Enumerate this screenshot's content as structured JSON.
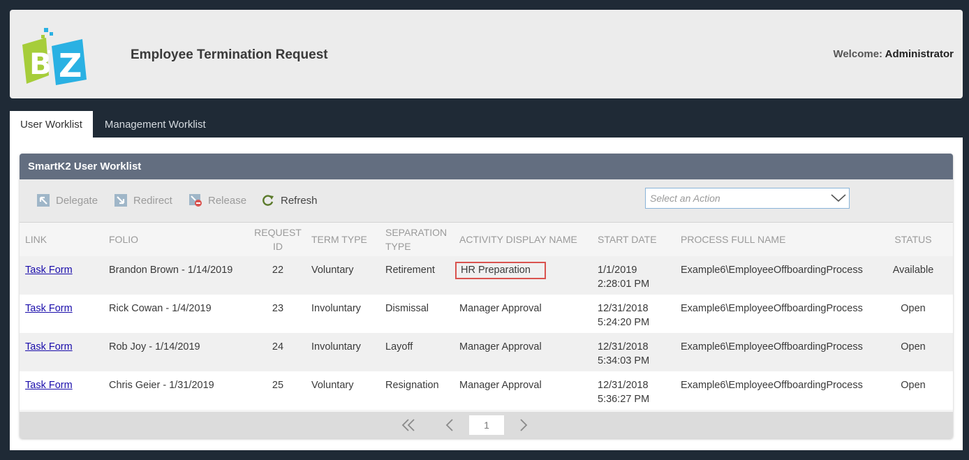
{
  "header": {
    "title": "Employee Termination Request",
    "welcome_label": "Welcome:",
    "user": "Administrator"
  },
  "tabs": [
    {
      "label": "User Worklist",
      "active": true
    },
    {
      "label": "Management Worklist",
      "active": false
    }
  ],
  "panel": {
    "title": "SmartK2 User Worklist",
    "toolbar": {
      "delegate": "Delegate",
      "redirect": "Redirect",
      "release": "Release",
      "refresh": "Refresh",
      "action_placeholder": "Select an Action"
    },
    "columns": [
      "LINK",
      "FOLIO",
      "REQUEST ID",
      "TERM TYPE",
      "SEPARATION TYPE",
      "ACTIVITY DISPLAY NAME",
      "START DATE",
      "PROCESS FULL NAME",
      "STATUS"
    ],
    "rows": [
      {
        "link": "Task Form",
        "folio": "Brandon Brown - 1/14/2019",
        "request_id": "22",
        "term_type": "Voluntary",
        "separation_type": "Retirement",
        "activity": "HR Preparation",
        "start_date": "1/1/2019",
        "start_time": "2:28:01 PM",
        "process": "Example6\\EmployeeOffboardingProcess",
        "status": "Available"
      },
      {
        "link": "Task Form",
        "folio": "Rick Cowan - 1/4/2019",
        "request_id": "23",
        "term_type": "Involuntary",
        "separation_type": "Dismissal",
        "activity": "Manager Approval",
        "start_date": "12/31/2018",
        "start_time": "5:24:20 PM",
        "process": "Example6\\EmployeeOffboardingProcess",
        "status": "Open"
      },
      {
        "link": "Task Form",
        "folio": "Rob Joy - 1/14/2019",
        "request_id": "24",
        "term_type": "Involuntary",
        "separation_type": "Layoff",
        "activity": "Manager Approval",
        "start_date": "12/31/2018",
        "start_time": "5:34:03 PM",
        "process": "Example6\\EmployeeOffboardingProcess",
        "status": "Open"
      },
      {
        "link": "Task Form",
        "folio": "Chris Geier - 1/31/2019",
        "request_id": "25",
        "term_type": "Voluntary",
        "separation_type": "Resignation",
        "activity": "Manager Approval",
        "start_date": "12/31/2018",
        "start_time": "5:36:27 PM",
        "process": "Example6\\EmployeeOffboardingProcess",
        "status": "Open"
      }
    ],
    "pager": {
      "page": "1"
    }
  },
  "colors": {
    "background": "#1f2a36",
    "panel_header": "#636e80",
    "highlight": "#d9534f",
    "logo_green": "#a6cd3a",
    "logo_blue": "#2ab1e3"
  }
}
